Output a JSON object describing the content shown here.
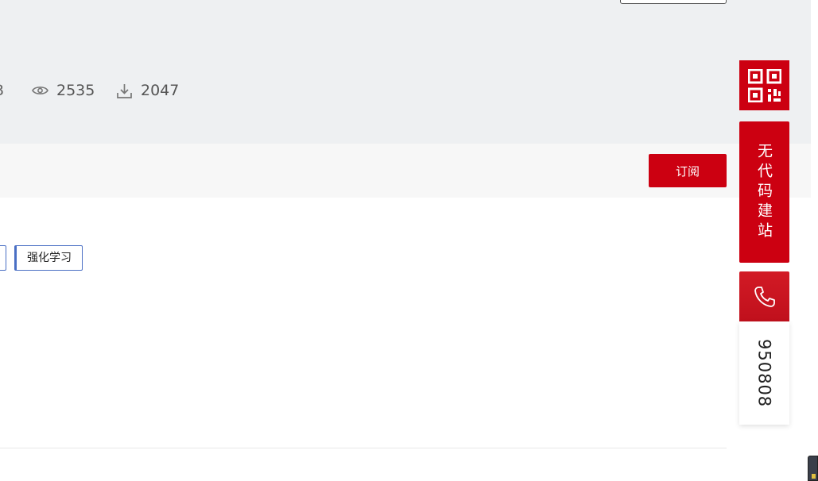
{
  "resource": {
    "size_fragment": "B",
    "views": "2535",
    "downloads": "2047",
    "subscribe_label": "订阅"
  },
  "tags": {
    "items": [
      "",
      "强化学习"
    ]
  },
  "sidebar": {
    "nocode_label": "无代码建站",
    "phone_number": "950808"
  },
  "icons": {
    "views": "eye-icon",
    "downloads": "download-icon",
    "qr": "qr-code-icon",
    "phone": "phone-icon"
  },
  "colors": {
    "brand_red": "#cc0011",
    "tag_border": "#4a6fc4",
    "hero_bg": "#eef0f2"
  }
}
